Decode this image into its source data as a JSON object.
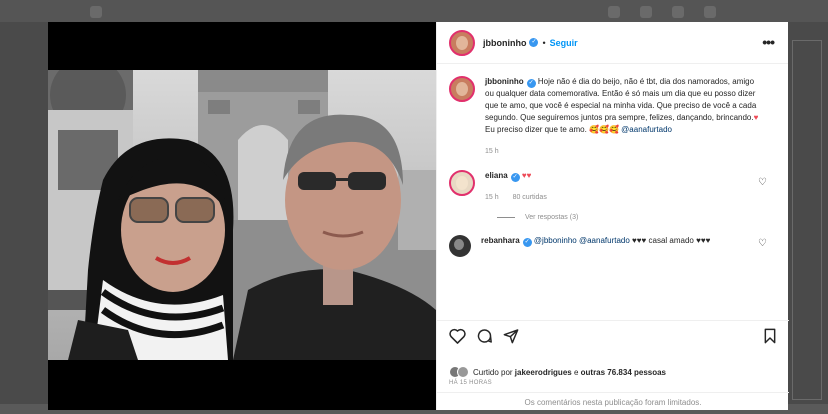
{
  "post": {
    "username": "jbboninho",
    "follow_label": "Seguir",
    "separator": "•",
    "more_label": "•••",
    "caption_lead": "Hoje não é dia do beijo, não é tbt, dia dos namorados, amigo ou qualquer data comemorativa. Então é só mais um dia que eu posso dizer que te amo, que você é especial na minha vida. Que preciso de você a cada segundo. Que seguiremos juntos pra sempre, felizes, dançando, brincando.",
    "caption_tail": " Eu preciso dizer que te amo. 🥰🥰🥰 ",
    "caption_mention": "@aanafurtado",
    "caption_time": "15 h"
  },
  "comments": [
    {
      "username": "eliana",
      "hearts": "♥♥",
      "time": "15 h",
      "likes": "80 curtidas",
      "replies": "Ver respostas (3)"
    },
    {
      "username": "rebanhara",
      "mention1": "@jbboninho",
      "mention2": "@aanafurtado",
      "text": "♥♥♥ casal amado ♥♥♥"
    }
  ],
  "liked_by": {
    "prefix": "Curtido por ",
    "user": "jakeerodrigues",
    "middle": " e ",
    "others": "outras 76.834 pessoas"
  },
  "timestamp": "HÁ 15 HORAS",
  "limited_notice": "Os comentários nesta publicação foram limitados.",
  "icons": {
    "like": "heart-icon",
    "comment": "comment-icon",
    "share": "share-icon",
    "save": "bookmark-icon"
  },
  "colors": {
    "link_blue": "#0095f6",
    "heart_red": "#ed4956",
    "verified_blue": "#3897f0"
  }
}
